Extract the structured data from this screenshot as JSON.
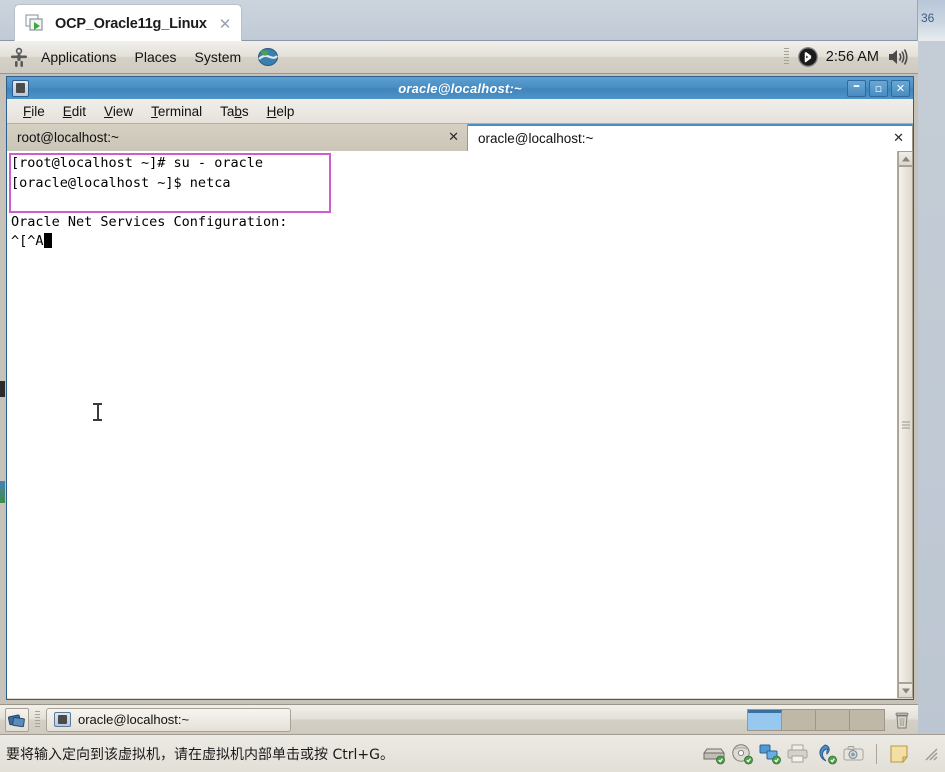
{
  "vmware": {
    "tab": {
      "title": "OCP_Oracle11g_Linux",
      "close": "✕",
      "icon": "vm-stacked-windows-icon"
    },
    "right_fragment_number": "36",
    "statusbar": {
      "message": "要将输入定向到该虚拟机，请在虚拟机内部单击或按 Ctrl+G。",
      "devices": [
        {
          "name": "hard-disk-icon"
        },
        {
          "name": "cd-dvd-icon"
        },
        {
          "name": "network-adapter-icon"
        },
        {
          "name": "printer-icon"
        },
        {
          "name": "usb-icon"
        },
        {
          "name": "camera-icon"
        }
      ],
      "note_icon": "sticky-note-icon",
      "resize_grip": "resize-grip"
    }
  },
  "gnome": {
    "top_panel": {
      "logo_icon": "redhat-shadowman-icon",
      "menus": [
        {
          "label": "Applications"
        },
        {
          "label": "Places"
        },
        {
          "label": "System"
        }
      ],
      "browser_icon": "globe-browser-icon",
      "bluetooth_icon": "bluetooth-icon",
      "clock": "2:56 AM",
      "volume_icon": "volume-speaker-icon"
    },
    "bottom_panel": {
      "show_desktop_icon": "show-desktop-icon",
      "window_button": {
        "label": "oracle@localhost:~",
        "icon": "terminal-icon"
      },
      "workspaces": [
        {
          "name": "workspace-1",
          "active": true
        },
        {
          "name": "workspace-2",
          "active": false
        },
        {
          "name": "workspace-3",
          "active": false
        },
        {
          "name": "workspace-4",
          "active": false
        }
      ],
      "trash_icon": "trash-icon"
    }
  },
  "terminal": {
    "title": "oracle@localhost:~",
    "window_buttons": {
      "minimize": "–",
      "maximize": "▫",
      "close": "✕"
    },
    "menus": [
      {
        "label": "File",
        "mnemonic": "F",
        "rest": "ile"
      },
      {
        "label": "Edit",
        "mnemonic": "E",
        "rest": "dit"
      },
      {
        "label": "View",
        "mnemonic": "V",
        "rest": "iew"
      },
      {
        "label": "Terminal",
        "mnemonic": "T",
        "rest": "erminal"
      },
      {
        "label": "Tabs",
        "pre": "Ta",
        "mnemonic": "b",
        "rest": "s"
      },
      {
        "label": "Help",
        "mnemonic": "H",
        "rest": "elp"
      }
    ],
    "tabs": [
      {
        "label": "root@localhost:~",
        "close": "✕",
        "active": false
      },
      {
        "label": "oracle@localhost:~",
        "close": "✕",
        "active": true
      }
    ],
    "screen_lines": [
      {
        "text": "[root@localhost ~]# su - oracle"
      },
      {
        "text": "[oracle@localhost ~]$ netca"
      },
      {
        "text": ""
      },
      {
        "text": "Oracle Net Services Configuration:"
      },
      {
        "text": "^[^A",
        "cursor": true
      }
    ],
    "annotation": {
      "name": "magenta-highlight-box",
      "color": "#cc5fcc"
    },
    "scrollbar": {
      "up_arrow": "scroll-up-arrow",
      "down_arrow": "scroll-down-arrow",
      "thumb": "scroll-thumb"
    },
    "mouse_cursor": "ibeam-text-cursor"
  }
}
